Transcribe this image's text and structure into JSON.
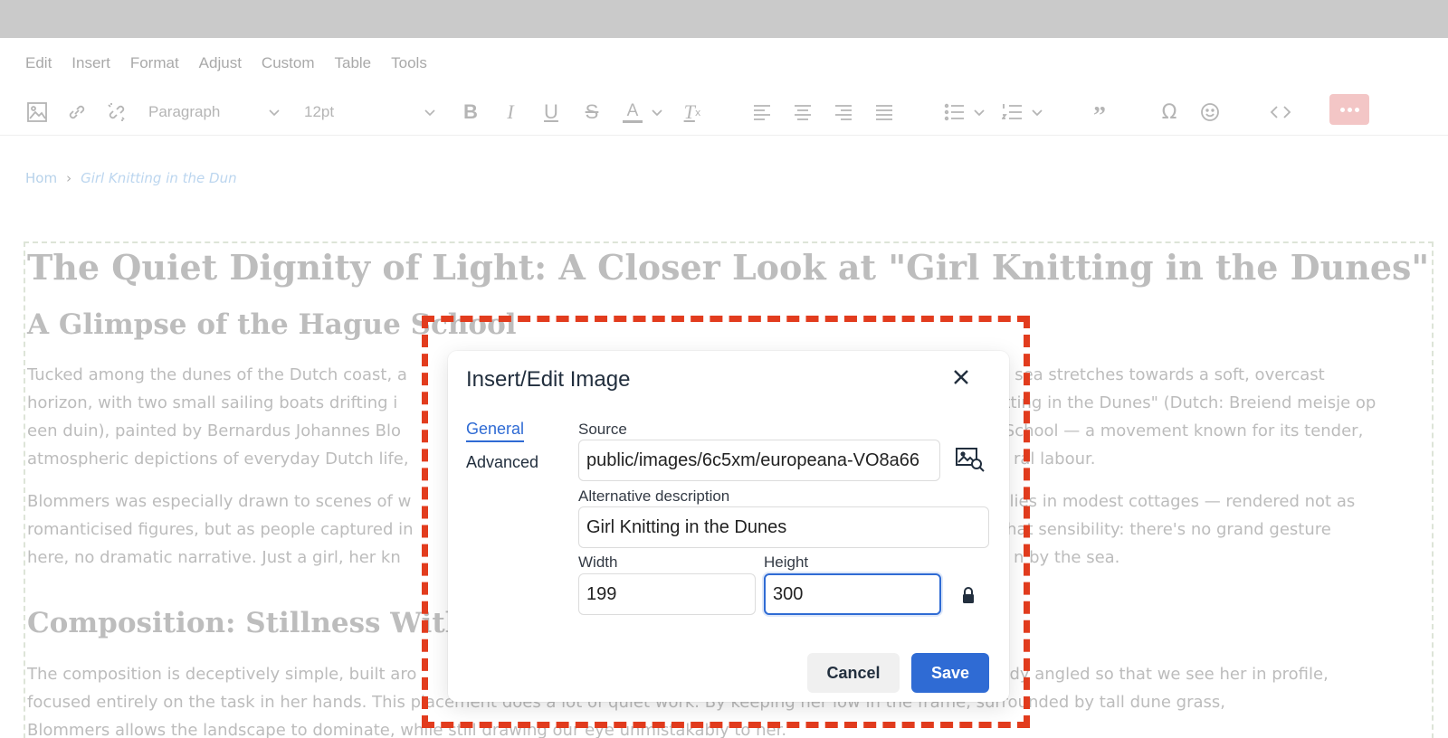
{
  "menu": [
    "Edit",
    "Insert",
    "Format",
    "Adjust",
    "Custom",
    "Table",
    "Tools"
  ],
  "toolbar": {
    "block_format": "Paragraph",
    "font_size": "12pt",
    "icons": [
      "image-icon",
      "link-icon",
      "unlink-icon",
      "bold-icon",
      "italic-icon",
      "underline-icon",
      "strikethrough-icon",
      "text-color-icon",
      "clear-formatting-icon",
      "align-left-icon",
      "align-center-icon",
      "align-right-icon",
      "justify-icon",
      "bullet-list-icon",
      "numbered-list-icon",
      "blockquote-icon",
      "special-character-icon",
      "emoji-icon",
      "source-code-icon",
      "more-icon"
    ]
  },
  "breadcrumb": {
    "home": "Hom",
    "current": "Girl Knitting in the Dun"
  },
  "article": {
    "h1": "The Quiet Dignity of Light: A Closer Look at \"Girl Knitting in the Dunes\"",
    "h2a": "A Glimpse of the Hague School",
    "p1": [
      "Tucked among the dunes of the Dutch coast, a",
      "he sea stretches towards a soft, overcast",
      "horizon, with two small sailing boats drifting i",
      "nitting in the Dunes\" (Dutch: Breiend meisje op",
      "een duin), painted by Bernardus Johannes Blo",
      "e School — a movement known for its tender,",
      "atmospheric depictions of everyday Dutch life,",
      "ral labour."
    ],
    "p2": [
      "Blommers was especially drawn to scenes of w",
      "milies in modest cottages — rendered not as",
      "romanticised figures, but as people captured in",
      "f that sensibility: there's no grand gesture",
      "here, no dramatic narrative. Just a girl, her kn",
      "n by the sea."
    ],
    "h2b": "Composition: Stillness With",
    "p3": [
      "The composition is deceptively simple, built aro",
      "body angled so that we see her in profile,",
      "focused entirely on the task in her hands. This placement does a lot of quiet work. By keeping her low in the frame, surrounded by tall dune grass,",
      "Blommers allows the landscape to dominate, while still drawing our eye unmistakably to her."
    ]
  },
  "dialog": {
    "title": "Insert/Edit Image",
    "tabs": [
      "General",
      "Advanced"
    ],
    "source_label": "Source",
    "source_value": "public/images/6c5xm/europeana-VO8a66",
    "alt_label": "Alternative description",
    "alt_value": "Girl Knitting in the Dunes",
    "width_label": "Width",
    "width_value": "199",
    "height_label": "Height",
    "height_value": "300",
    "cancel": "Cancel",
    "save": "Save"
  },
  "colors": {
    "accent": "#2f6bd4",
    "highlight_border": "#e23c1e",
    "more_button": "#f3c6c6"
  }
}
